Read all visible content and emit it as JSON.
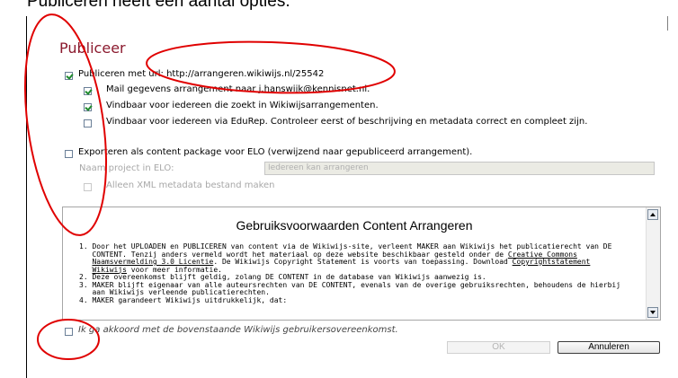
{
  "caption": "Publiceren heeft een aantal opties.",
  "dialog": {
    "title": "Publiceer",
    "publish": {
      "label": "Publiceren met url: http://arrangeren.wikiwijs.nl/25542",
      "checked": true
    },
    "mail": {
      "label": "Mail gegevens arrangement naar j.hanswijk@kennisnet.nl.",
      "checked": true
    },
    "wikiwijs_findable": {
      "label": "Vindbaar voor iedereen die zoekt in Wikiwijsarrangementen.",
      "checked": true
    },
    "edurep_findable": {
      "label": "Vindbaar voor iedereen via EduRep. Controleer eerst of beschrijving en metadata correct en compleet zijn.",
      "checked": false
    },
    "export": {
      "label": "Exporteren als content package voor ELO (verwijzend naar gepubliceerd arrangement).",
      "checked": false
    },
    "project_name": {
      "label": "Naam project in ELO:",
      "value": "Iedereen kan arrangeren"
    },
    "xml_only": {
      "label": "Alleen XML metadata bestand maken",
      "checked": false,
      "disabled": true
    },
    "terms": {
      "heading": "Gebruiksvoorwaarden Content Arrangeren",
      "item1_a": "1. Door het UPLOADEN en PUBLICEREN van content via de Wikiwijs-site, verleent MAKER aan Wikiwijs het publicatierecht van DE",
      "item1_b": "   CONTENT. Tenzij anders vermeld wordt het materiaal op deze website beschikbaar gesteld onder de ",
      "item1_link1": "Creative Commons",
      "item1_c_link": "Naamsvermelding 3.0 Licentie",
      "item1_c_text": ". De Wikiwijs Copyright Statement is voorts van toepassing. Download ",
      "item1_link2": "Copyrightstatement",
      "item1_d_link": "Wikiwijs",
      "item1_d_text": " voor meer informatie.",
      "item2": "2. Deze overeenkomst blijft geldig, zolang DE CONTENT in de database van Wikiwijs aanwezig is.",
      "item3_a": "3. MAKER blijft eigenaar van alle auteursrechten van DE CONTENT, evenals van de overige gebruiksrechten, behoudens de hierbij",
      "item3_b": "   aan Wikiwijs verleende publicatierechten.",
      "item4": "4. MAKER garandeert Wikiwijs uitdrukkelijk, dat:"
    },
    "agree": {
      "label": "Ik ga akkoord met de bovenstaande Wikiwijs gebruikersovereenkomst.",
      "checked": false
    },
    "ok_label": "OK",
    "cancel_label": "Annuleren"
  },
  "colors": {
    "title": "#8b1a2e",
    "annotation": "#e00000",
    "check": "#1f8a2d"
  }
}
